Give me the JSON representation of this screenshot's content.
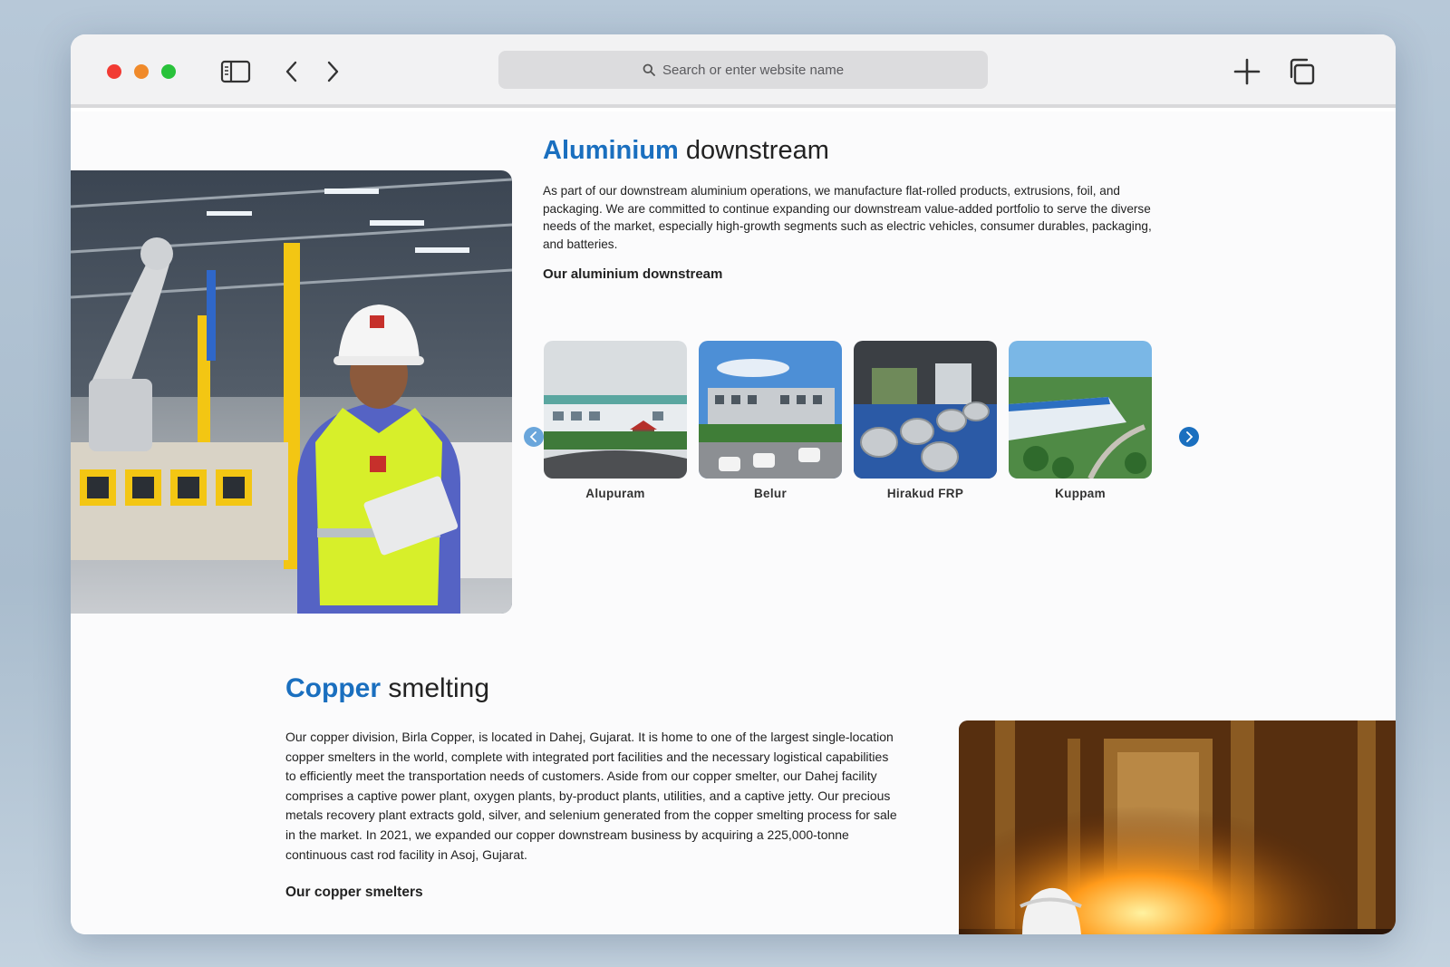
{
  "browser": {
    "search_placeholder": "Search or enter website name",
    "icons": [
      "sidebar-icon",
      "back-icon",
      "forward-icon",
      "search-icon",
      "new-tab-icon",
      "tabs-overview-icon"
    ]
  },
  "aluminium": {
    "title_accent": "Aluminium",
    "title_rest": " downstream",
    "body": "As part of our downstream aluminium operations, we manufacture flat-rolled products, extrusions, foil, and packaging. We are committed to continue expanding our downstream value-added portfolio to serve the diverse needs of the market, especially high-growth segments such as electric vehicles, consumer durables, packaging, and batteries.",
    "subheading": "Our aluminium downstream",
    "plants": [
      {
        "name": "Alupuram"
      },
      {
        "name": "Belur"
      },
      {
        "name": "Hirakud FRP"
      },
      {
        "name": "Kuppam"
      }
    ]
  },
  "copper": {
    "title_accent": "Copper",
    "title_rest": " smelting",
    "body": "Our copper division, Birla Copper, is located in Dahej, Gujarat. It is home to one of the largest single-location copper smelters in the world, complete with integrated port facilities and the necessary logistical capabilities to efficiently meet the transportation needs of customers. Aside from our copper smelter, our Dahej facility comprises a captive power plant, oxygen plants, by-product plants, utilities, and a captive jetty. Our precious metals recovery plant extracts gold, silver, and selenium generated from the copper smelting process for sale in the market. In 2021, we expanded our copper downstream business by acquiring a 225,000-tonne continuous cast rod facility in Asoj, Gujarat.",
    "subheading": "Our copper smelters"
  },
  "colors": {
    "accent": "#1a6fbf",
    "arrow_inactive": "#6aa6db"
  }
}
